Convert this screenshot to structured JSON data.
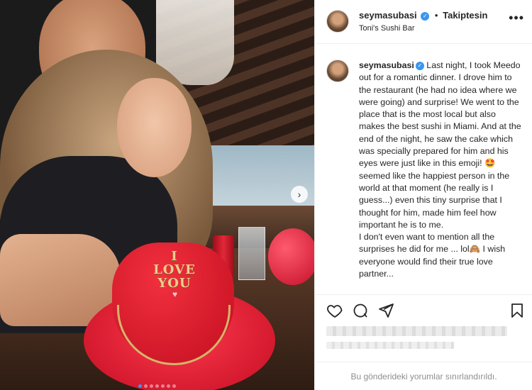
{
  "post": {
    "username": "seymasubasi",
    "verified_icon": "verified-badge-icon",
    "separator": "•",
    "follow_status": "Takiptesin",
    "location": "Toni's Sushi Bar",
    "more_icon": "more-options-icon"
  },
  "caption": {
    "username": "seymasubasi",
    "text_part1": "Last night, I took Meedo out for a romantic dinner. I drove him to the restaurant (he had no idea where we were going) and surprise! We went to the place that is the most local but also makes the best sushi in Miami. And at the end of the night, he saw the cake which was specially prepared for him and his eyes were just like in this emoji! 🤩 seemed like the happiest person in the world at that moment (he really is I guess...) even this tiny surprise that I thought for him, made him feel how important he is to me.",
    "text_part2": "I don't even want to mention all the surprises he did for me ... lol🙈 I wish everyone would find their true love partner..."
  },
  "photo": {
    "cake_line1": "I",
    "cake_line2": "LOVE",
    "cake_line3": "YOU",
    "carousel_count": 7,
    "carousel_active": 1,
    "next_icon": "chevron-right-icon"
  },
  "actions": {
    "like_icon": "heart-icon",
    "comment_icon": "comment-icon",
    "share_icon": "paper-plane-icon",
    "save_icon": "bookmark-icon"
  },
  "footer": {
    "comments_disabled": "Bu gönderideki yorumlar sınırlandırıldı."
  },
  "colors": {
    "accent": "#3897f0",
    "text": "#262626",
    "muted": "#8e8e8e",
    "border": "#efefef"
  }
}
